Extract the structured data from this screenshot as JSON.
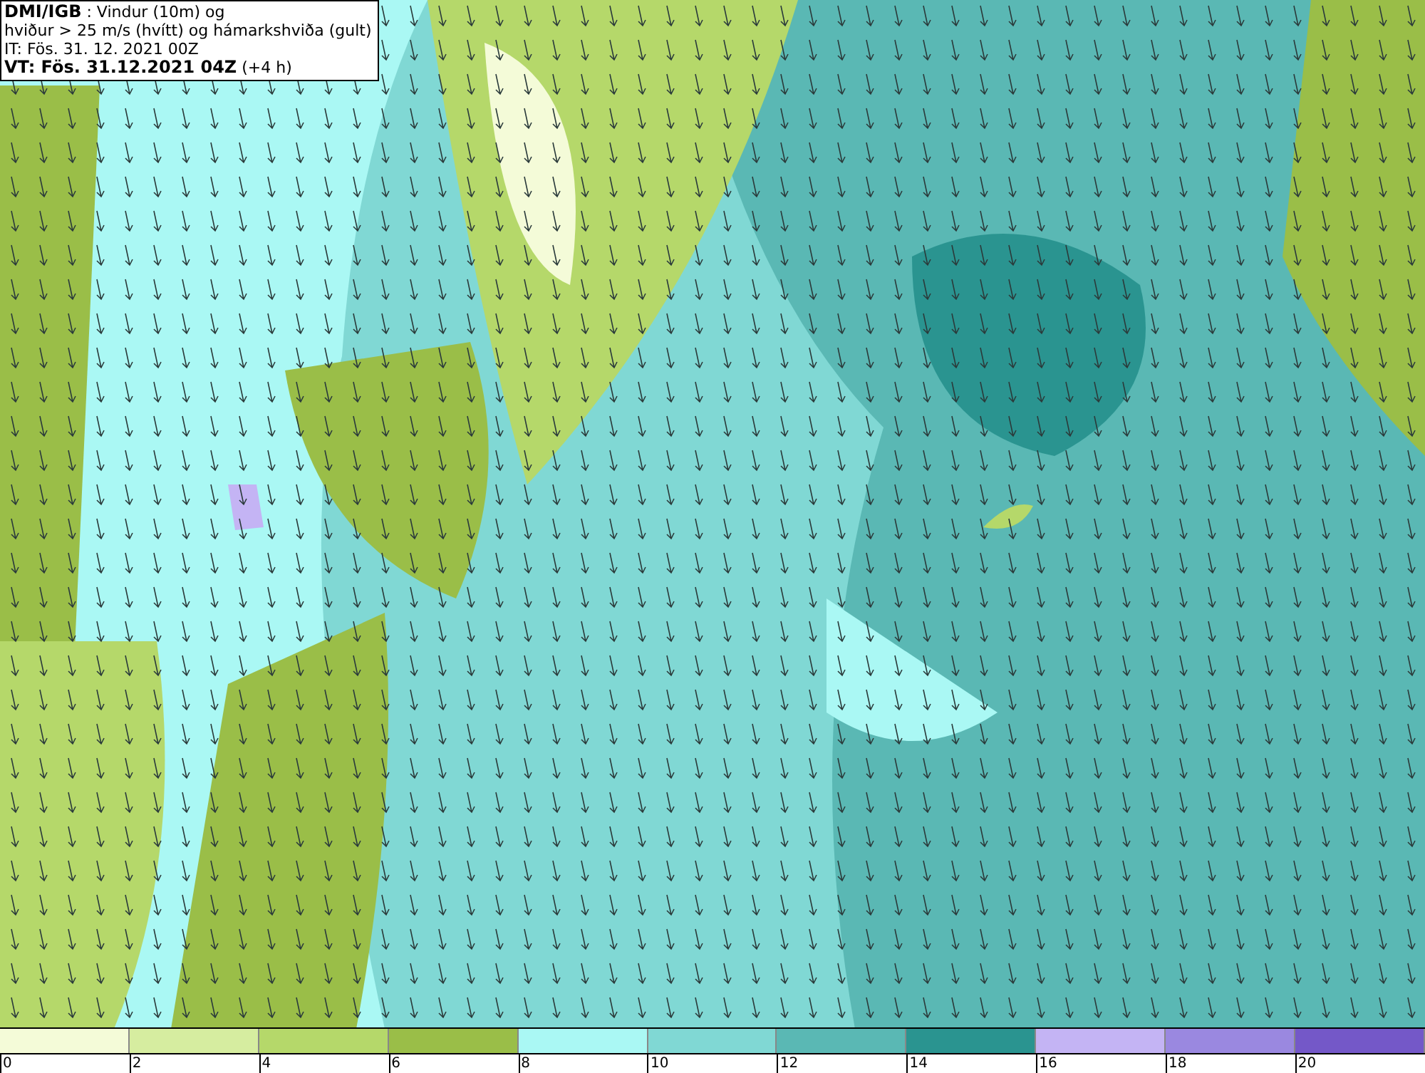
{
  "header": {
    "lines": [
      "**DMI/IGB** : Vindur (10m) og",
      "hviður > 25 m/s (hvítt) og hámarkshviða (gult)",
      "IT: Fös. 31. 12. 2021 00Z",
      "**VT: Fös. 31.12.2021 04Z** (+4 h)"
    ]
  },
  "legend": {
    "bins": [
      {
        "color": "#f4fbd8"
      },
      {
        "color": "#d6eda0"
      },
      {
        "color": "#b5d86a"
      },
      {
        "color": "#9abe48"
      },
      {
        "color": "#aaf8f4"
      },
      {
        "color": "#80d8d4"
      },
      {
        "color": "#5ab8b4"
      },
      {
        "color": "#2a9490"
      },
      {
        "color": "#c4b4f4"
      },
      {
        "color": "#9a88e0"
      },
      {
        "color": "#7458c8"
      }
    ],
    "ticks": [
      "0",
      "2",
      "4",
      "6",
      "8",
      "10",
      "12",
      "14",
      "16",
      "18",
      "20"
    ]
  }
}
